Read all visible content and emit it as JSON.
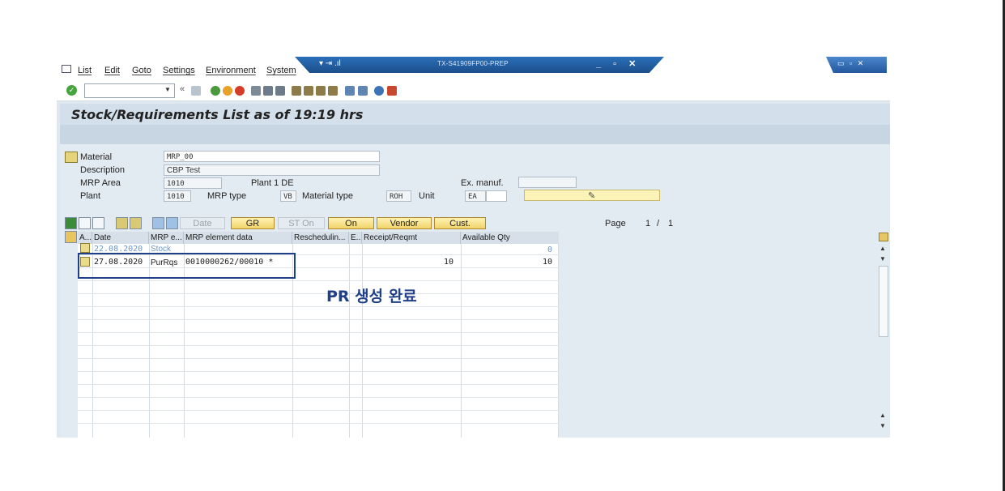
{
  "menu": [
    "List",
    "Edit",
    "Goto",
    "Settings",
    "Environment",
    "System"
  ],
  "window": {
    "title": "TX-S41909FP00-PREP"
  },
  "screen_title": "Stock/Requirements List as of 19:19 hrs",
  "header": {
    "material_label": "Material",
    "material_value": "MRP_00",
    "description_label": "Description",
    "description_value": "CBP Test",
    "mrp_area_label": "MRP Area",
    "mrp_area_value": "1010",
    "mrp_area_text": "Plant 1 DE",
    "plant_label": "Plant",
    "plant_value": "1010",
    "mrp_type_label": "MRP type",
    "mrp_type_value": "VB",
    "material_type_label": "Material type",
    "material_type_value": "ROH",
    "unit_label": "Unit",
    "unit_value": "EA",
    "ex_manuf_label": "Ex. manuf."
  },
  "grid_toolbar": {
    "date": "Date",
    "gr": "GR",
    "st_on": "ST On",
    "on": "On",
    "vendor": "Vendor",
    "cust": "Cust.",
    "page_label": "Page",
    "page_current": "1",
    "page_sep": "/",
    "page_total": "1"
  },
  "grid": {
    "columns": [
      "A...",
      "Date",
      "MRP e...",
      "MRP element data",
      "Reschedulin...",
      "E...",
      "Receipt/Reqmt",
      "Available Qty"
    ],
    "rows": [
      {
        "date": "22.08.2020",
        "mrp_element": "Stock",
        "element_data": "",
        "receipt": "",
        "available": "0"
      },
      {
        "date": "27.08.2020",
        "mrp_element": "PurRqs",
        "element_data": "0010000262/00010 *",
        "receipt": "10",
        "available": "10"
      }
    ]
  },
  "annotation": "PR 생성 완료",
  "colors": {
    "highlight": "#1f3f86",
    "title_bar": "#2a6fb8"
  }
}
